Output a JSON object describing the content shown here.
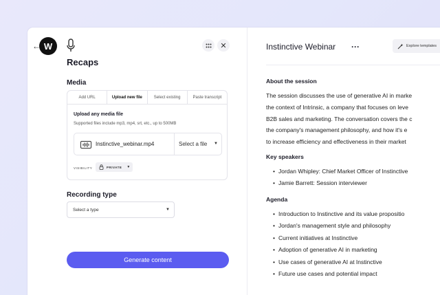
{
  "app": {
    "title": "Recaps",
    "accent": "#5b5cf0",
    "logo_letter": "W"
  },
  "media": {
    "label": "Media",
    "tabs": [
      {
        "label": "Add URL"
      },
      {
        "label": "Upload new file",
        "active": true
      },
      {
        "label": "Select existing"
      },
      {
        "label": "Paste transcript"
      }
    ],
    "upload_title": "Upload any media file",
    "upload_subtitle": "Supported files include mp3, mp4, srt, etc., up to 500MB",
    "file_name": "Instinctive_webinar.mp4",
    "select_file_label": "Select a file",
    "visibility_label": "VISIBILITY",
    "visibility_value": "PRIVATE"
  },
  "recording": {
    "label": "Recording type",
    "placeholder": "Select a type"
  },
  "actions": {
    "generate_label": "Generate content"
  },
  "document": {
    "title": "Instinctive Webinar",
    "more": "···",
    "explore_label": "Explore templates",
    "about_heading": "About the session",
    "about_lines": [
      "The session discusses the use of generative AI in marke",
      "the context of Intrinsic, a company that focuses on leve",
      "B2B sales and marketing. The conversation covers the c",
      "the company's management philosophy, and how it's e",
      "to increase efficiency and effectiveness in their market"
    ],
    "speakers_heading": "Key speakers",
    "speakers": [
      "Jordan Whipley: Chief Market Officer of Instinctive",
      "Jamie Barrett: Session interviewer"
    ],
    "agenda_heading": "Agenda",
    "agenda": [
      "Introduction to Instinctive and its value propositio",
      "Jordan's management style and philosophy",
      "Current initiatives at Instinctive",
      "Adoption of generative AI in marketing",
      "Use cases of generative AI at Instinctive",
      "Future use cases and potential impact"
    ]
  }
}
